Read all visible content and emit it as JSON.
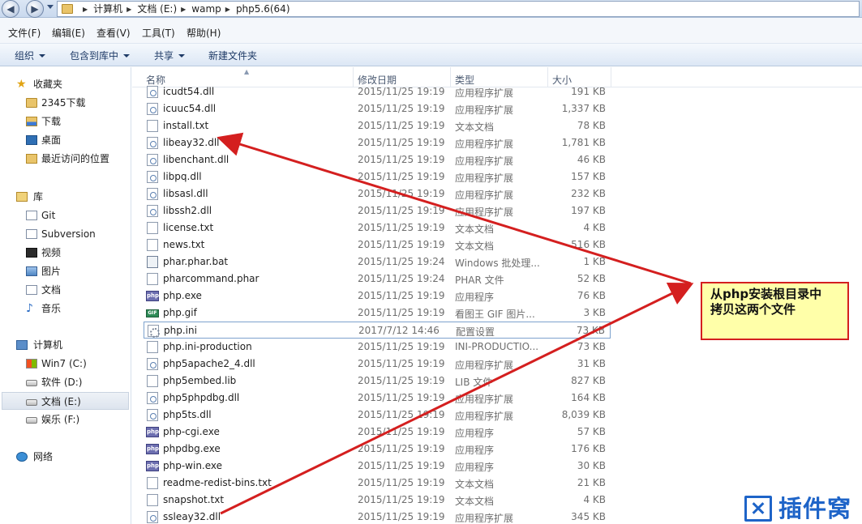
{
  "address": {
    "crumbs": [
      "计算机",
      "文档 (E:)",
      "wamp",
      "php5.6(64)"
    ]
  },
  "menu": [
    "文件(F)",
    "编辑(E)",
    "查看(V)",
    "工具(T)",
    "帮助(H)"
  ],
  "commands": {
    "organize": "组织",
    "include_library": "包含到库中",
    "share": "共享",
    "new_folder": "新建文件夹"
  },
  "nav": {
    "favorites": "收藏夹",
    "fav_items": [
      "2345下载",
      "下载",
      "桌面",
      "最近访问的位置"
    ],
    "libraries": "库",
    "lib_items": [
      "Git",
      "Subversion",
      "视频",
      "图片",
      "文档",
      "音乐"
    ],
    "computer": "计算机",
    "drives": [
      "Win7 (C:)",
      "软件 (D:)",
      "文档 (E:)",
      "娱乐 (F:)"
    ],
    "network": "网络"
  },
  "columns": {
    "name": "名称",
    "date": "修改日期",
    "type": "类型",
    "size": "大小"
  },
  "files": [
    {
      "name": "icudt54.dll",
      "date": "2015/11/25 19:19",
      "type": "应用程序扩展",
      "size": "191 KB"
    },
    {
      "name": "icuuc54.dll",
      "date": "2015/11/25 19:19",
      "type": "应用程序扩展",
      "size": "1,337 KB"
    },
    {
      "name": "install.txt",
      "date": "2015/11/25 19:19",
      "type": "文本文档",
      "size": "78 KB"
    },
    {
      "name": "libeay32.dll",
      "date": "2015/11/25 19:19",
      "type": "应用程序扩展",
      "size": "1,781 KB"
    },
    {
      "name": "libenchant.dll",
      "date": "2015/11/25 19:19",
      "type": "应用程序扩展",
      "size": "46 KB"
    },
    {
      "name": "libpq.dll",
      "date": "2015/11/25 19:19",
      "type": "应用程序扩展",
      "size": "157 KB"
    },
    {
      "name": "libsasl.dll",
      "date": "2015/11/25 19:19",
      "type": "应用程序扩展",
      "size": "232 KB"
    },
    {
      "name": "libssh2.dll",
      "date": "2015/11/25 19:19",
      "type": "应用程序扩展",
      "size": "197 KB"
    },
    {
      "name": "license.txt",
      "date": "2015/11/25 19:19",
      "type": "文本文档",
      "size": "4 KB"
    },
    {
      "name": "news.txt",
      "date": "2015/11/25 19:19",
      "type": "文本文档",
      "size": "516 KB"
    },
    {
      "name": "phar.phar.bat",
      "date": "2015/11/25 19:24",
      "type": "Windows 批处理...",
      "size": "1 KB"
    },
    {
      "name": "pharcommand.phar",
      "date": "2015/11/25 19:24",
      "type": "PHAR 文件",
      "size": "52 KB"
    },
    {
      "name": "php.exe",
      "date": "2015/11/25 19:19",
      "type": "应用程序",
      "size": "76 KB"
    },
    {
      "name": "php.gif",
      "date": "2015/11/25 19:19",
      "type": "看图王 GIF 图片...",
      "size": "3 KB"
    },
    {
      "name": "php.ini",
      "date": "2017/7/12 14:46",
      "type": "配置设置",
      "size": "73 KB"
    },
    {
      "name": "php.ini-production",
      "date": "2015/11/25 19:19",
      "type": "INI-PRODUCTIO...",
      "size": "73 KB"
    },
    {
      "name": "php5apache2_4.dll",
      "date": "2015/11/25 19:19",
      "type": "应用程序扩展",
      "size": "31 KB"
    },
    {
      "name": "php5embed.lib",
      "date": "2015/11/25 19:19",
      "type": "LIB 文件",
      "size": "827 KB"
    },
    {
      "name": "php5phpdbg.dll",
      "date": "2015/11/25 19:19",
      "type": "应用程序扩展",
      "size": "164 KB"
    },
    {
      "name": "php5ts.dll",
      "date": "2015/11/25 19:19",
      "type": "应用程序扩展",
      "size": "8,039 KB"
    },
    {
      "name": "php-cgi.exe",
      "date": "2015/11/25 19:19",
      "type": "应用程序",
      "size": "57 KB"
    },
    {
      "name": "phpdbg.exe",
      "date": "2015/11/25 19:19",
      "type": "应用程序",
      "size": "176 KB"
    },
    {
      "name": "php-win.exe",
      "date": "2015/11/25 19:19",
      "type": "应用程序",
      "size": "30 KB"
    },
    {
      "name": "readme-redist-bins.txt",
      "date": "2015/11/25 19:19",
      "type": "文本文档",
      "size": "21 KB"
    },
    {
      "name": "snapshot.txt",
      "date": "2015/11/25 19:19",
      "type": "文本文档",
      "size": "4 KB"
    },
    {
      "name": "ssleay32.dll",
      "date": "2015/11/25 19:19",
      "type": "应用程序扩展",
      "size": "345 KB"
    }
  ],
  "callout": {
    "line1": "从php安装根目录中",
    "line2": "拷贝这两个文件"
  },
  "watermark": "插件窝",
  "colors": {
    "arrow": "#d41f1f",
    "callout_bg": "#ffffa9",
    "watermark": "#1e64c8"
  }
}
